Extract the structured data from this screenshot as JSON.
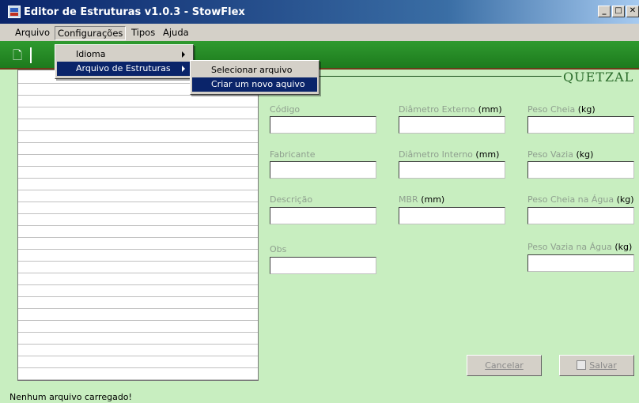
{
  "window": {
    "title": "Editor de Estruturas v1.0.3 - StowFlex",
    "controls": {
      "minimize": "_",
      "maximize": "□",
      "close": "✕"
    }
  },
  "menubar": {
    "items": [
      {
        "label": "Arquivo"
      },
      {
        "label": "Configurações",
        "active": true
      },
      {
        "label": "Tipos"
      },
      {
        "label": "Ajuda"
      }
    ]
  },
  "config_menu": {
    "items": [
      {
        "label": "Idioma",
        "has_submenu": true
      },
      {
        "label": "Arquivo de Estruturas",
        "has_submenu": true,
        "selected": true
      }
    ]
  },
  "structures_submenu": {
    "items": [
      {
        "label": "Selecionar arquivo"
      },
      {
        "label": "Criar um novo aquivo",
        "selected": true
      }
    ]
  },
  "toolbar": {
    "icons": [
      "new-file-icon"
    ]
  },
  "logo": {
    "text": "QUETZAL"
  },
  "form": {
    "codigo": {
      "label": "Código",
      "unit": "",
      "value": ""
    },
    "fabricante": {
      "label": "Fabricante",
      "unit": "",
      "value": ""
    },
    "descricao": {
      "label": "Descrição",
      "unit": "",
      "value": ""
    },
    "obs": {
      "label": "Obs",
      "unit": "",
      "value": ""
    },
    "diam_ext": {
      "label": "Diâmetro Externo",
      "unit": "(mm)",
      "value": ""
    },
    "diam_int": {
      "label": "Diâmetro Interno",
      "unit": "(mm)",
      "value": ""
    },
    "mbr": {
      "label": "MBR",
      "unit": "(mm)",
      "value": ""
    },
    "peso_cheia": {
      "label": "Peso Cheia",
      "unit": "(kg)",
      "value": ""
    },
    "peso_vazia": {
      "label": "Peso Vazia",
      "unit": "(kg)",
      "value": ""
    },
    "peso_cheia_agua": {
      "label": "Peso Cheia na Água",
      "unit": "(kg)",
      "value": ""
    },
    "peso_vazia_agua": {
      "label": "Peso Vazia na Água",
      "unit": "(kg)",
      "value": ""
    }
  },
  "buttons": {
    "cancel": "Cancelar",
    "save": "Salvar"
  },
  "status": {
    "text": "Nenhum arquivo carregado!"
  },
  "colors": {
    "background": "#c8eec0",
    "toolbar": "#228b22",
    "title_start": "#0a246a",
    "menu_highlight": "#0a246a",
    "logo": "#2a6b2a"
  }
}
